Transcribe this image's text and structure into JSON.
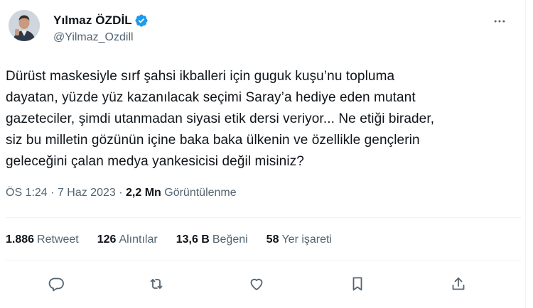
{
  "author": {
    "name": "Yılmaz ÖZDİL",
    "handle": "@Yilmaz_Ozdill",
    "verified": true
  },
  "tweet": {
    "lines": [
      "Dürüst maskesiyle sırf şahsi ikballeri için guguk kuşu’nu topluma",
      "dayatan, yüzde yüz kazanılacak seçimi Saray’a hediye eden mutant",
      "gazeteciler, şimdi utanmadan siyasi etik dersi veriyor... Ne etiği birader,",
      "siz bu milletin gözünün içine baka baka ülkenin ve özellikle gençlerin",
      "geleceğini çalan medya yankesicisi değil misiniz?"
    ]
  },
  "meta": {
    "time": "ÖS 1:24",
    "separator": "·",
    "date": "7 Haz 2023",
    "views_count": "2,2 Mn",
    "views_label": "Görüntülenme"
  },
  "stats": {
    "retweets": {
      "count": "1.886",
      "label": "Retweet"
    },
    "quotes": {
      "count": "126",
      "label": "Alıntılar"
    },
    "likes": {
      "count": "13,6 B",
      "label": "Beğeni"
    },
    "bookmarks": {
      "count": "58",
      "label": "Yer işareti"
    }
  },
  "icons": {
    "more": "more-dots-icon",
    "reply": "reply-icon",
    "retweet": "retweet-icon",
    "like": "heart-icon",
    "bookmark": "bookmark-icon",
    "share": "share-icon",
    "verified": "verified-badge-icon"
  },
  "colors": {
    "verified": "#1d9bf0",
    "secondary_text": "#536471",
    "icon": "#536471"
  }
}
